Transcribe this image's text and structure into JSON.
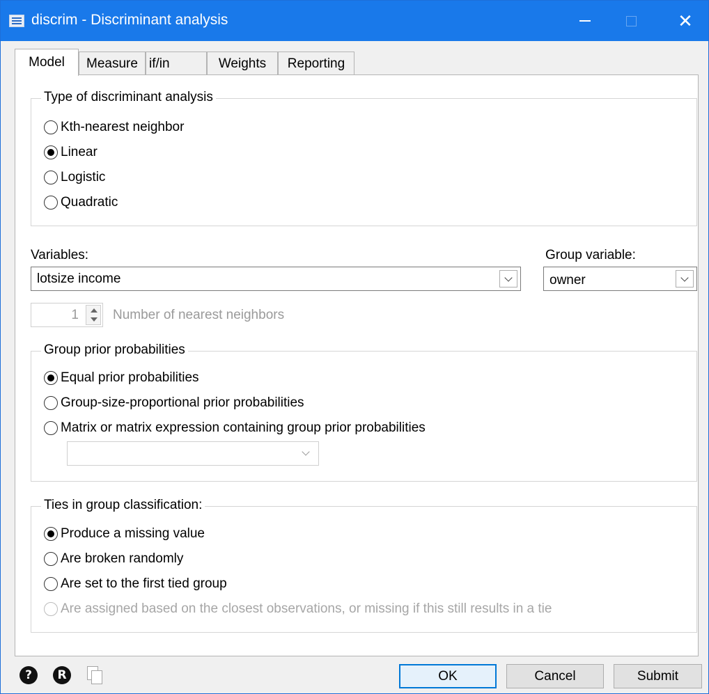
{
  "window": {
    "title": "discrim - Discriminant analysis"
  },
  "tabs": [
    {
      "label": "Model",
      "active": true
    },
    {
      "label": "Measure",
      "active": false
    },
    {
      "label": "if/in",
      "active": false
    },
    {
      "label": "Weights",
      "active": false
    },
    {
      "label": "Reporting",
      "active": false
    }
  ],
  "analysis_type": {
    "legend": "Type of discriminant analysis",
    "options": [
      {
        "label": "Kth-nearest neighbor",
        "selected": false
      },
      {
        "label": "Linear",
        "selected": true
      },
      {
        "label": "Logistic",
        "selected": false
      },
      {
        "label": "Quadratic",
        "selected": false
      }
    ]
  },
  "variables": {
    "label": "Variables:",
    "value": "lotsize income"
  },
  "group_variable": {
    "label": "Group variable:",
    "value": "owner"
  },
  "knn": {
    "value": "1",
    "label": "Number of nearest neighbors",
    "enabled": false
  },
  "priors": {
    "legend": "Group prior probabilities",
    "options": [
      {
        "label": "Equal prior probabilities",
        "selected": true
      },
      {
        "label": "Group-size-proportional prior probabilities",
        "selected": false
      },
      {
        "label": "Matrix or matrix expression containing group prior probabilities",
        "selected": false
      }
    ],
    "matrix_value": ""
  },
  "ties": {
    "legend": "Ties in group classification:",
    "options": [
      {
        "label": "Produce a missing value",
        "selected": true,
        "enabled": true
      },
      {
        "label": "Are broken randomly",
        "selected": false,
        "enabled": true
      },
      {
        "label": "Are set to the first tied group",
        "selected": false,
        "enabled": true
      },
      {
        "label": "Are assigned based on the closest observations, or missing if this still results in a tie",
        "selected": false,
        "enabled": false
      }
    ]
  },
  "footer": {
    "help_glyph": "?",
    "reset_glyph": "R",
    "ok_label": "OK",
    "cancel_label": "Cancel",
    "submit_label": "Submit"
  },
  "colors": {
    "titlebar": "#1979ea",
    "default_button_border": "#0078d7",
    "disabled_text": "#a6a6a6"
  },
  "icons": [
    "window-app-icon",
    "minimize-icon",
    "maximize-icon",
    "close-icon",
    "help-icon",
    "reset-icon",
    "copy-command-icon",
    "chevron-down-icon",
    "spinner-up-icon",
    "spinner-down-icon"
  ]
}
